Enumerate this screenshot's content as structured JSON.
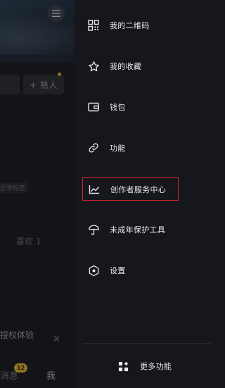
{
  "background": {
    "add_friend_label": "+ 熟人",
    "dot_text": "·",
    "tag_text": "区等标签",
    "likes_tab_label": "喜欢 1",
    "auth_text": "授权体验",
    "close_symbol": "×",
    "messages_tab_label": "消息",
    "messages_badge": "12",
    "me_tab_label": "我"
  },
  "drawer": {
    "items": [
      {
        "label": "我的二维码",
        "icon": "qr-code-icon"
      },
      {
        "label": "我的收藏",
        "icon": "star-icon"
      },
      {
        "label": "钱包",
        "icon": "wallet-icon"
      },
      {
        "label": "功能",
        "icon": "link-icon"
      },
      {
        "label": "创作者服务中心",
        "icon": "chart-line-icon",
        "highlighted": true
      },
      {
        "label": "未成年保护工具",
        "icon": "umbrella-icon"
      },
      {
        "label": "设置",
        "icon": "settings-icon"
      }
    ],
    "more_label": "更多功能"
  },
  "colors": {
    "highlight_border": "#d1242f",
    "badge": "#c9a227",
    "drawer_bg": "#16171d"
  }
}
